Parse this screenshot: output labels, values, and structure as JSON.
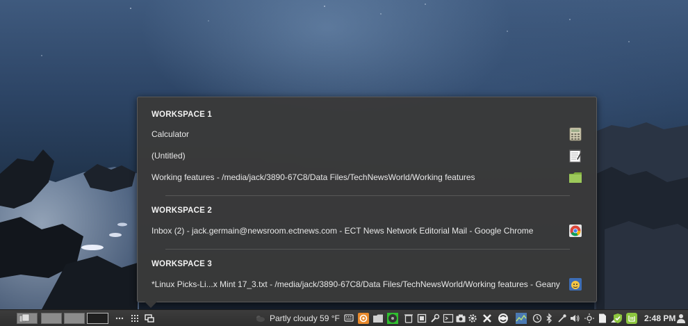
{
  "workspace_popup": {
    "groups": [
      {
        "heading": "WORKSPACE 1",
        "windows": [
          {
            "title": "Calculator",
            "icon": "calculator-icon"
          },
          {
            "title": "(Untitled)",
            "icon": "text-editor-icon"
          },
          {
            "title": "Working features - /media/jack/3890-67C8/Data Files/TechNewsWorld/Working features",
            "icon": "folder-icon"
          }
        ]
      },
      {
        "heading": "WORKSPACE 2",
        "windows": [
          {
            "title": "Inbox (2) - jack.germain@newsroom.ectnews.com - ECT News Network Editorial Mail - Google Chrome",
            "icon": "chrome-icon"
          }
        ]
      },
      {
        "heading": "WORKSPACE 3",
        "windows": [
          {
            "title": "*Linux Picks-Li...x Mint 17_3.txt - /media/jack/3890-67C8/Data Files/TechNewsWorld/Working features - Geany",
            "icon": "geany-icon"
          }
        ]
      }
    ]
  },
  "taskbar": {
    "weather": "Partly cloudy 59 °F",
    "clock": "2:48 PM"
  },
  "colors": {
    "popup_bg": "#3a3a3a",
    "taskbar_bg": "#333333",
    "accent_green": "#8dc63f"
  }
}
